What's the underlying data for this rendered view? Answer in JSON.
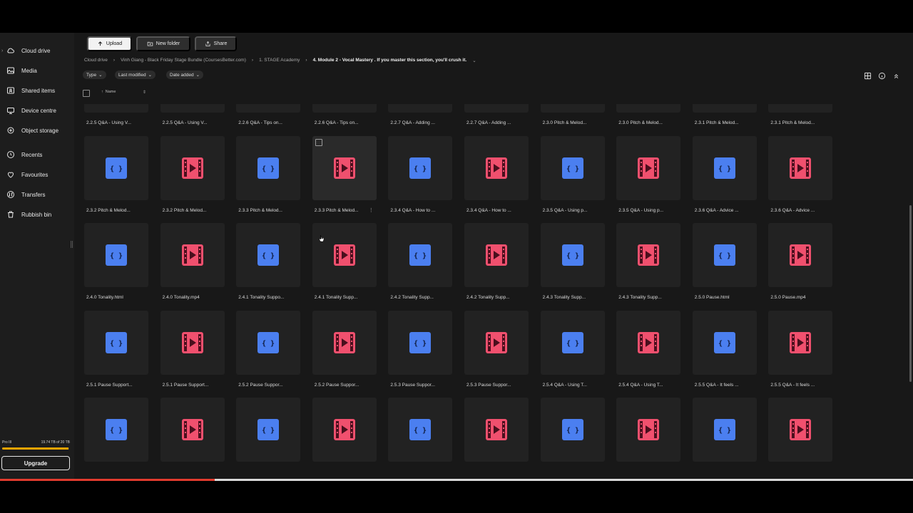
{
  "sidebar": {
    "items": [
      {
        "label": "Cloud drive",
        "icon": "cloud-icon"
      },
      {
        "label": "Media",
        "icon": "image-icon"
      },
      {
        "label": "Shared items",
        "icon": "shared-folder-icon"
      },
      {
        "label": "Device centre",
        "icon": "device-icon"
      },
      {
        "label": "Object storage",
        "icon": "object-storage-icon"
      },
      {
        "label": "Recents",
        "icon": "clock-icon"
      },
      {
        "label": "Favourites",
        "icon": "heart-icon"
      },
      {
        "label": "Transfers",
        "icon": "transfers-icon"
      },
      {
        "label": "Rubbish bin",
        "icon": "trash-icon"
      }
    ],
    "plan": "Pro III",
    "storage_text": "19.74 TB of 20 TB",
    "storage_fraction": 0.987,
    "storage_color": "#f0a400",
    "upgrade_label": "Upgrade"
  },
  "toolbar": {
    "upload_label": "Upload",
    "new_folder_label": "New folder",
    "share_label": "Share"
  },
  "breadcrumb": [
    "Cloud drive",
    "Vinh Giang - Black Friday Stage Bundle (CoursesBetter.com)",
    "1. STAGE Academy",
    "4. Module 2 - Vocal Mastery . If you master this section, you'll crush it."
  ],
  "filters": [
    "Type",
    "Last modified",
    "Date added"
  ],
  "list_header": {
    "name_label": "Name"
  },
  "colors": {
    "html_icon": "#4b7ff0",
    "video_icon": "#f0506e",
    "tile_bg": "#222222",
    "page_bg": "#181818",
    "sidebar_bg": "#1d1d1d"
  },
  "files": [
    {
      "name": "2.2.5 Q&A - Using V...",
      "type": "html"
    },
    {
      "name": "2.2.5 Q&A - Using V...",
      "type": "video"
    },
    {
      "name": "2.2.6 Q&A - Tips on...",
      "type": "html"
    },
    {
      "name": "2.2.6 Q&A - Tips on...",
      "type": "video"
    },
    {
      "name": "2.2.7 Q&A - Adding ...",
      "type": "html"
    },
    {
      "name": "2.2.7 Q&A - Adding ...",
      "type": "video"
    },
    {
      "name": "2.3.0 Pitch & Melod...",
      "type": "html"
    },
    {
      "name": "2.3.0 Pitch & Melod...",
      "type": "video"
    },
    {
      "name": "2.3.1 Pitch & Melod...",
      "type": "html"
    },
    {
      "name": "2.3.1 Pitch & Melod...",
      "type": "video"
    },
    {
      "name": "2.3.2 Pitch & Melod...",
      "type": "html"
    },
    {
      "name": "2.3.2 Pitch & Melod...",
      "type": "video"
    },
    {
      "name": "2.3.3 Pitch & Melod...",
      "type": "html"
    },
    {
      "name": "2.3.3 Pitch & Melod...",
      "type": "video"
    },
    {
      "name": "2.3.4 Q&A - How to ...",
      "type": "html"
    },
    {
      "name": "2.3.4 Q&A - How to ...",
      "type": "video"
    },
    {
      "name": "2.3.5 Q&A - Using p...",
      "type": "html"
    },
    {
      "name": "2.3.5 Q&A - Using p...",
      "type": "video"
    },
    {
      "name": "2.3.6 Q&A - Advice ...",
      "type": "html"
    },
    {
      "name": "2.3.6 Q&A - Advice ...",
      "type": "video"
    },
    {
      "name": "2.4.0 Tonality.html",
      "type": "html"
    },
    {
      "name": "2.4.0 Tonality.mp4",
      "type": "video"
    },
    {
      "name": "2.4.1 Tonality Suppo...",
      "type": "html"
    },
    {
      "name": "2.4.1 Tonality Supp...",
      "type": "video"
    },
    {
      "name": "2.4.2 Tonality Supp...",
      "type": "html"
    },
    {
      "name": "2.4.2 Tonality Supp...",
      "type": "video"
    },
    {
      "name": "2.4.3 Tonality Supp...",
      "type": "html"
    },
    {
      "name": "2.4.3 Tonality Supp...",
      "type": "video"
    },
    {
      "name": "2.5.0 Pause.html",
      "type": "html"
    },
    {
      "name": "2.5.0 Pause.mp4",
      "type": "video"
    },
    {
      "name": "2.5.1 Pause Support...",
      "type": "html"
    },
    {
      "name": "2.5.1 Pause Support...",
      "type": "video"
    },
    {
      "name": "2.5.2 Pause Suppor...",
      "type": "html"
    },
    {
      "name": "2.5.2 Pause Suppor...",
      "type": "video"
    },
    {
      "name": "2.5.3 Pause Suppor...",
      "type": "html"
    },
    {
      "name": "2.5.3 Pause Suppor...",
      "type": "video"
    },
    {
      "name": "2.5.4 Q&A - Using T...",
      "type": "html"
    },
    {
      "name": "2.5.4 Q&A - Using T...",
      "type": "video"
    },
    {
      "name": "2.5.5 Q&A - It feels ...",
      "type": "html"
    },
    {
      "name": "2.5.5 Q&A - It feels ...",
      "type": "video"
    },
    {
      "name": "",
      "type": "html"
    },
    {
      "name": "",
      "type": "video"
    },
    {
      "name": "",
      "type": "html"
    },
    {
      "name": "",
      "type": "video"
    },
    {
      "name": "",
      "type": "html"
    },
    {
      "name": "",
      "type": "video"
    },
    {
      "name": "",
      "type": "html"
    },
    {
      "name": "",
      "type": "video"
    },
    {
      "name": "",
      "type": "html"
    },
    {
      "name": "",
      "type": "video"
    }
  ],
  "hovered_file_index": 13,
  "video_progress_fraction": 0.235
}
